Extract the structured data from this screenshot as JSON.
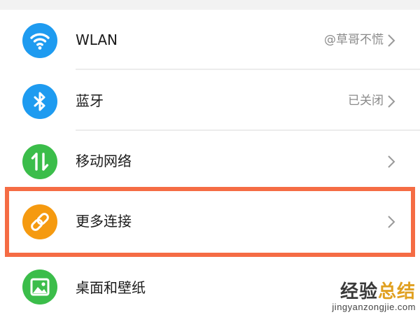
{
  "settings": {
    "items": [
      {
        "label": "WLAN",
        "value": "@草哥不慌",
        "icon": "wifi-icon",
        "icon_color": "#1e9bf0"
      },
      {
        "label": "蓝牙",
        "value": "已关闭",
        "icon": "bluetooth-icon",
        "icon_color": "#1e9bf0"
      },
      {
        "label": "移动网络",
        "value": "",
        "icon": "mobile-data-icon",
        "icon_color": "#3bbd4a"
      },
      {
        "label": "更多连接",
        "value": "",
        "icon": "link-icon",
        "icon_color": "#f59a10",
        "highlighted": true
      },
      {
        "label": "桌面和壁纸",
        "value": "",
        "icon": "wallpaper-icon",
        "icon_color": "#3bbd4a"
      }
    ]
  },
  "highlight_color": "#f56c44",
  "watermark": {
    "title_a": "经验",
    "title_b": "总结",
    "url": "jingyanzongjie.com"
  }
}
